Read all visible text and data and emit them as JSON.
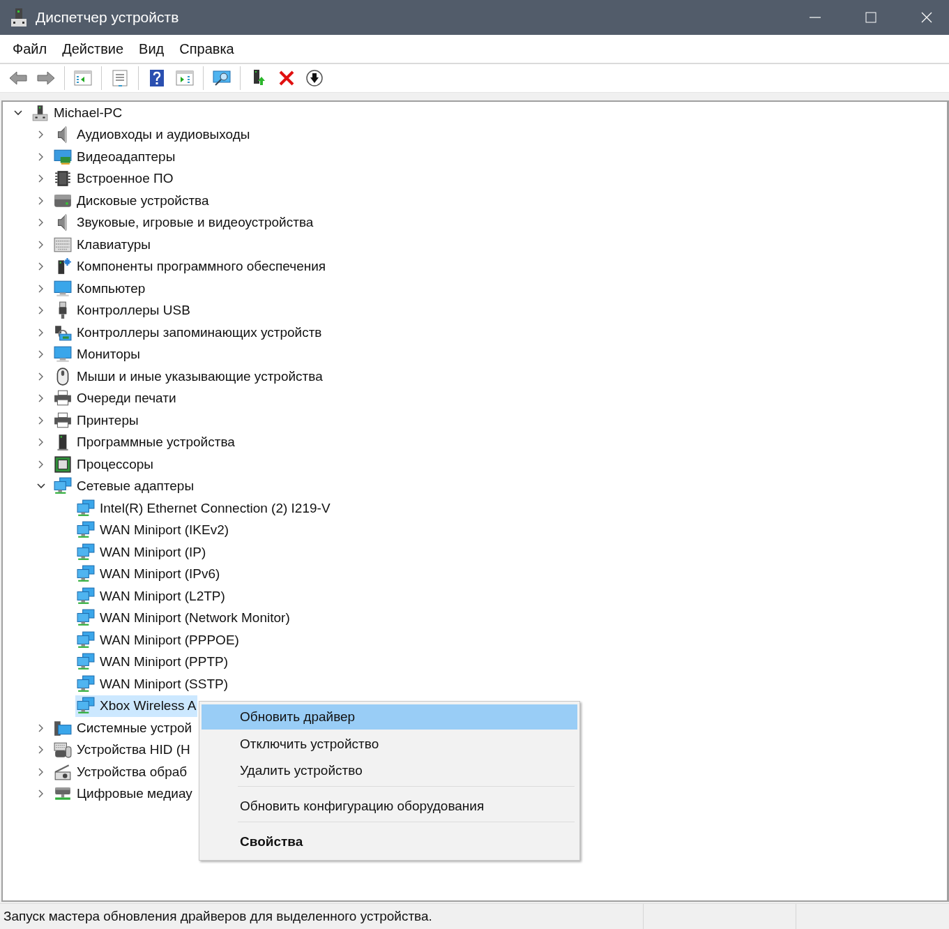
{
  "window": {
    "title": "Диспетчер устройств"
  },
  "menu_bar": [
    "Файл",
    "Действие",
    "Вид",
    "Справка"
  ],
  "toolbar": [
    {
      "kind": "back"
    },
    {
      "kind": "forward"
    },
    {
      "kind": "separator"
    },
    {
      "kind": "console-tree"
    },
    {
      "kind": "separator"
    },
    {
      "kind": "properties"
    },
    {
      "kind": "separator"
    },
    {
      "kind": "help"
    },
    {
      "kind": "action-pane"
    },
    {
      "kind": "separator"
    },
    {
      "kind": "scan"
    },
    {
      "kind": "separator"
    },
    {
      "kind": "update-driver"
    },
    {
      "kind": "uninstall"
    },
    {
      "kind": "disable"
    }
  ],
  "tree": {
    "root": {
      "label": "Michael-PC",
      "kind": "computer",
      "expanded": true,
      "selected": false,
      "children": [
        {
          "label": "Аудиовходы и аудиовыходы",
          "kind": "speaker",
          "expanded": false,
          "selected": false
        },
        {
          "label": "Видеоадаптеры",
          "kind": "display-adapter",
          "expanded": false,
          "selected": false
        },
        {
          "label": "Встроенное ПО",
          "kind": "chip",
          "expanded": false,
          "selected": false
        },
        {
          "label": "Дисковые устройства",
          "kind": "disk",
          "expanded": false,
          "selected": false
        },
        {
          "label": "Звуковые, игровые и видеоустройства",
          "kind": "speaker",
          "expanded": false,
          "selected": false
        },
        {
          "label": "Клавиатуры",
          "kind": "keyboard",
          "expanded": false,
          "selected": false
        },
        {
          "label": "Компоненты программного обеспечения",
          "kind": "software-component",
          "expanded": false,
          "selected": false
        },
        {
          "label": "Компьютер",
          "kind": "monitor",
          "expanded": false,
          "selected": false
        },
        {
          "label": "Контроллеры USB",
          "kind": "usb",
          "expanded": false,
          "selected": false
        },
        {
          "label": "Контроллеры запоминающих устройств",
          "kind": "storage-controller",
          "expanded": false,
          "selected": false
        },
        {
          "label": "Мониторы",
          "kind": "monitor",
          "expanded": false,
          "selected": false
        },
        {
          "label": "Мыши и иные указывающие устройства",
          "kind": "mouse",
          "expanded": false,
          "selected": false
        },
        {
          "label": "Очереди печати",
          "kind": "printer",
          "expanded": false,
          "selected": false
        },
        {
          "label": "Принтеры",
          "kind": "printer",
          "expanded": false,
          "selected": false
        },
        {
          "label": "Программные устройства",
          "kind": "software-device",
          "expanded": false,
          "selected": false
        },
        {
          "label": "Процессоры",
          "kind": "processor",
          "expanded": false,
          "selected": false
        },
        {
          "label": "Сетевые адаптеры",
          "kind": "network",
          "expanded": true,
          "selected": false,
          "children": [
            {
              "label": "Intel(R) Ethernet Connection (2) I219-V",
              "kind": "network",
              "selected": false
            },
            {
              "label": "WAN Miniport (IKEv2)",
              "kind": "network",
              "selected": false
            },
            {
              "label": "WAN Miniport (IP)",
              "kind": "network",
              "selected": false
            },
            {
              "label": "WAN Miniport (IPv6)",
              "kind": "network",
              "selected": false
            },
            {
              "label": "WAN Miniport (L2TP)",
              "kind": "network",
              "selected": false
            },
            {
              "label": "WAN Miniport (Network Monitor)",
              "kind": "network",
              "selected": false
            },
            {
              "label": "WAN Miniport (PPPOE)",
              "kind": "network",
              "selected": false
            },
            {
              "label": "WAN Miniport (PPTP)",
              "kind": "network",
              "selected": false
            },
            {
              "label": "WAN Miniport (SSTP)",
              "kind": "network",
              "selected": false
            },
            {
              "label": "Xbox Wireless A",
              "kind": "network",
              "selected": true
            }
          ]
        },
        {
          "label": "Системные устрой",
          "kind": "system",
          "expanded": false,
          "selected": false
        },
        {
          "label": "Устройства HID (H",
          "kind": "hid",
          "expanded": false,
          "selected": false
        },
        {
          "label": "Устройства обраб",
          "kind": "imaging",
          "expanded": false,
          "selected": false
        },
        {
          "label": "Цифровые медиау",
          "kind": "media",
          "expanded": false,
          "selected": false
        }
      ]
    }
  },
  "context_menu": [
    {
      "kind": "command",
      "label": "Обновить драйвер",
      "selected": true
    },
    {
      "kind": "command",
      "label": "Отключить устройство",
      "selected": false
    },
    {
      "kind": "command",
      "label": "Удалить устройство",
      "selected": false
    },
    {
      "kind": "separator"
    },
    {
      "kind": "command",
      "label": "Обновить конфигурацию оборудования",
      "selected": false
    },
    {
      "kind": "separator"
    },
    {
      "kind": "default",
      "label": "Свойства",
      "selected": false
    }
  ],
  "status_bar": {
    "text": "Запуск мастера обновления драйверов для выделенного устройства."
  }
}
